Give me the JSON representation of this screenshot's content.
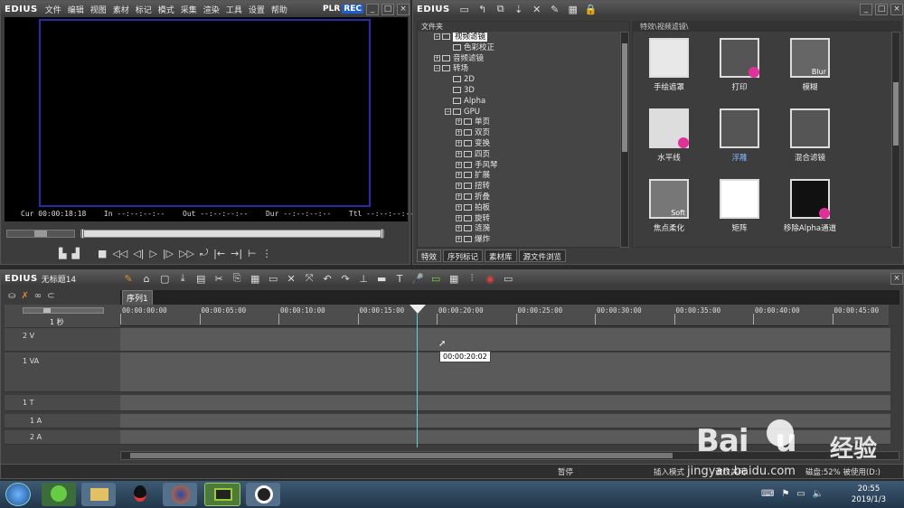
{
  "app": {
    "logo": "EDIUS"
  },
  "player": {
    "menu": [
      "文件",
      "编辑",
      "视图",
      "素材",
      "标记",
      "模式",
      "采集",
      "渲染",
      "工具",
      "设置",
      "帮助"
    ],
    "plr": "PLR",
    "rec": "REC",
    "cur_label": "Cur",
    "cur_value": "00:00:18:18",
    "in_label": "In",
    "in_value": "--:--:--:--",
    "out_label": "Out",
    "out_value": "--:--:--:--",
    "dur_label": "Dur",
    "dur_value": "--:--:--:--",
    "ttl_label": "Ttl",
    "ttl_value": "--:--:--:--"
  },
  "effects": {
    "logo": "EDIUS",
    "tree_header": "文件夹",
    "path": "特效\\视频滤镜\\",
    "tree": [
      {
        "label": "视频滤镜",
        "indent": 1,
        "selected": true
      },
      {
        "label": "色彩校正",
        "indent": 2
      },
      {
        "label": "音频滤镜",
        "indent": 1
      },
      {
        "label": "转场",
        "indent": 1
      },
      {
        "label": "2D",
        "indent": 2
      },
      {
        "label": "3D",
        "indent": 2
      },
      {
        "label": "Alpha",
        "indent": 2
      },
      {
        "label": "GPU",
        "indent": 2
      },
      {
        "label": "单页",
        "indent": 3
      },
      {
        "label": "双页",
        "indent": 3
      },
      {
        "label": "变换",
        "indent": 3
      },
      {
        "label": "四页",
        "indent": 3
      },
      {
        "label": "手风琴",
        "indent": 3
      },
      {
        "label": "扩展",
        "indent": 3
      },
      {
        "label": "扭转",
        "indent": 3
      },
      {
        "label": "折叠",
        "indent": 3
      },
      {
        "label": "拍板",
        "indent": 3
      },
      {
        "label": "旋转",
        "indent": 3
      },
      {
        "label": "涟漪",
        "indent": 3
      },
      {
        "label": "爆炸",
        "indent": 3
      }
    ],
    "items": [
      {
        "label": "手绘遮罩"
      },
      {
        "label": "打印"
      },
      {
        "label": "模糊",
        "overlay": "Blur"
      },
      {
        "label": "水平线"
      },
      {
        "label": "浮雕"
      },
      {
        "label": "混合滤镜"
      },
      {
        "label": "焦点柔化",
        "overlay": "Soft"
      },
      {
        "label": "矩阵"
      },
      {
        "label": "移除Alpha通道"
      }
    ],
    "tabs": [
      "特效",
      "序列标记",
      "素材库",
      "源文件浏览"
    ]
  },
  "timeline": {
    "logo": "EDIUS",
    "project": "无标题14",
    "sequence_tab": "序列1",
    "scale": "1 秒",
    "ruler": [
      "00:00:00:00",
      "00:00:05:00",
      "00:00:10:00",
      "00:00:15:00",
      "00:00:20:00",
      "00:00:25:00",
      "00:00:30:00",
      "00:00:35:00",
      "00:00:40:00",
      "00:00:45:00"
    ],
    "tracks": [
      "2 V",
      "1 VA",
      "1 T",
      "1 A",
      "2 A"
    ],
    "tooltip": "00:00:20:02",
    "status": {
      "pause": "暂停",
      "mode": "插入模式",
      "ripple": "波纹关闭",
      "disk": "磁盘:52% 被使用(D:)"
    }
  },
  "taskbar": {
    "time": "20:55",
    "date": "2019/1/3"
  },
  "watermark": {
    "site": "jingyan.baidu.com",
    "brand": "经验"
  }
}
